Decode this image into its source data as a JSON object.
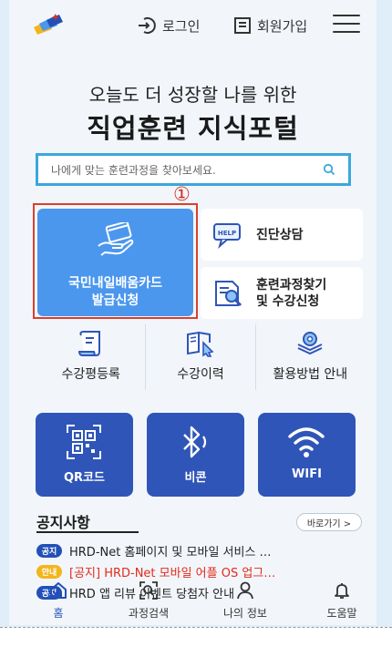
{
  "header": {
    "login_label": "로그인",
    "signup_label": "회원가입"
  },
  "hero": {
    "subtitle": "오늘도 더 성장할 나를 위한",
    "title": "직업훈련 지식포털"
  },
  "search": {
    "placeholder": "나에게 맞는 훈련과정을 찾아보세요."
  },
  "annotation": {
    "marker": "①"
  },
  "card_button": {
    "line1": "국민내일배움카드",
    "line2": "발급신청"
  },
  "side_buttons": {
    "diagnosis": "진단상담",
    "find_line1": "훈련과정찾기",
    "find_line2": "및 수강신청"
  },
  "quick_menu": [
    {
      "label": "수강평등록"
    },
    {
      "label": "수강이력"
    },
    {
      "label": "활용방법 안내"
    }
  ],
  "tiles": [
    {
      "label": "QR코드"
    },
    {
      "label": "비콘"
    },
    {
      "label": "WIFI"
    }
  ],
  "notices": {
    "title": "공지사항",
    "more_label": "바로가기 >",
    "items": [
      {
        "badge": "공지",
        "text": "HRD-Net 홈페이지 및 모바일 서비스 …"
      },
      {
        "badge": "안내",
        "text": "[공지] HRD-Net 모바일 어플 OS 업그…"
      },
      {
        "badge": "공지",
        "text": "HRD 앱 리뷰 이벤트 당첨자 안내"
      }
    ]
  },
  "tabbar": [
    {
      "label": "홈"
    },
    {
      "label": "과정검색"
    },
    {
      "label": "나의 정보"
    },
    {
      "label": "도움말"
    }
  ],
  "colors": {
    "accent_blue": "#4b97ee",
    "tile_blue": "#2f55b8",
    "badge_notice": "#2350b7",
    "badge_info": "#f3b51c",
    "highlight_red": "#d9402d",
    "search_border": "#3ba7dd"
  }
}
